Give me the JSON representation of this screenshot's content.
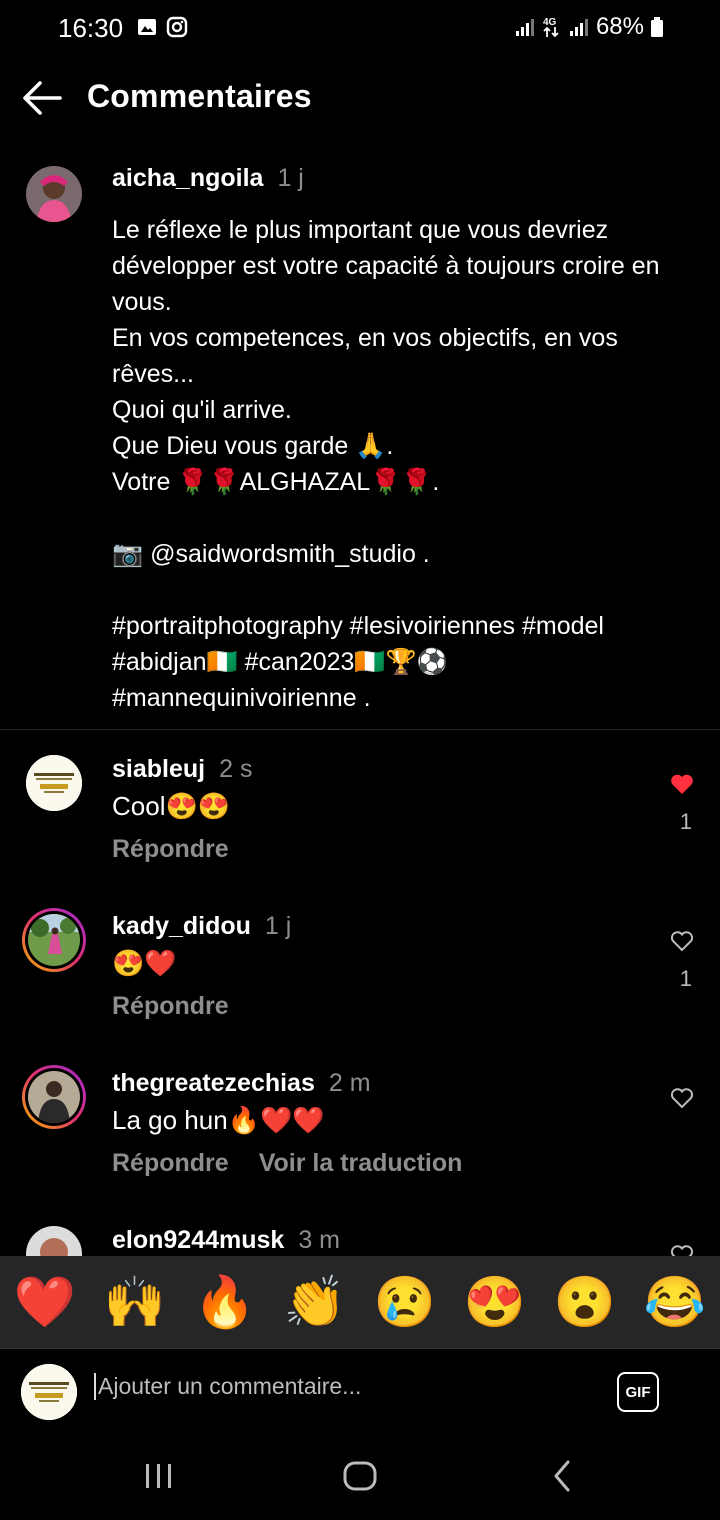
{
  "status_bar": {
    "time": "16:30",
    "battery": "68%"
  },
  "header": {
    "title": "Commentaires"
  },
  "caption": {
    "username": "aicha_ngoila",
    "time": "1 j",
    "text": "Le réflexe le plus important que vous devriez développer est votre capacité à toujours croire en vous.\nEn vos competences, en vos objectifs, en vos rêves...\nQuoi qu'il arrive.\nQue Dieu vous garde 🙏.\nVotre 🌹🌹ALGHAZAL🌹🌹.\n\n📷 @saidwordsmith_studio .\n\n#portraitphotography #lesivoiriennes #model #abidjan🇨🇮 #can2023🇨🇮🏆⚽ #mannequinivoirienne ."
  },
  "comments": [
    {
      "username": "siableuj",
      "time": "2 s",
      "text": "Cool😍😍",
      "reply": "Répondre",
      "likes": "1",
      "liked": true
    },
    {
      "username": "kady_didou",
      "time": "1 j",
      "text": "😍❤️",
      "reply": "Répondre",
      "likes": "1",
      "liked": false
    },
    {
      "username": "thegreatezechias",
      "time": "2 m",
      "text": "La go hun🔥❤️❤️",
      "reply": "Répondre",
      "translate": "Voir la traduction",
      "liked": false
    },
    {
      "username": "elon9244musk",
      "time": "3 m"
    }
  ],
  "emoji_bar": [
    "❤️",
    "🙌",
    "🔥",
    "👏",
    "😢",
    "😍",
    "😮",
    "😂"
  ],
  "input": {
    "placeholder": "Ajouter un commentaire...",
    "gif": "GIF"
  },
  "colors": {
    "like_red": "#ff3040",
    "muted": "#8e8e8e"
  }
}
